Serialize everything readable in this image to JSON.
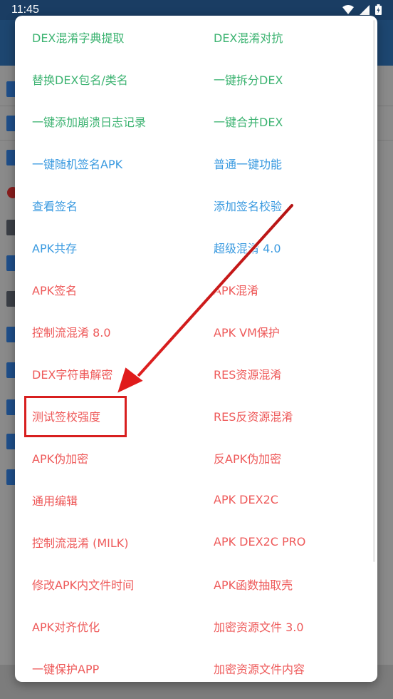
{
  "status_bar": {
    "time": "11:45"
  },
  "menu": {
    "rows": [
      {
        "left": {
          "label": "DEX混淆字典提取",
          "color": "green"
        },
        "right": {
          "label": "DEX混淆对抗",
          "color": "green"
        }
      },
      {
        "left": {
          "label": "替换DEX包名/类名",
          "color": "green"
        },
        "right": {
          "label": "一键拆分DEX",
          "color": "green"
        }
      },
      {
        "left": {
          "label": "一键添加崩溃日志记录",
          "color": "green"
        },
        "right": {
          "label": "一键合并DEX",
          "color": "green"
        }
      },
      {
        "left": {
          "label": "一键随机签名APK",
          "color": "blue"
        },
        "right": {
          "label": "普通一键功能",
          "color": "blue"
        }
      },
      {
        "left": {
          "label": "查看签名",
          "color": "blue"
        },
        "right": {
          "label": "添加签名校验",
          "color": "blue"
        }
      },
      {
        "left": {
          "label": "APK共存",
          "color": "blue"
        },
        "right": {
          "label": "超级混淆 4.0",
          "color": "blue"
        }
      },
      {
        "left": {
          "label": "APK签名",
          "color": "red"
        },
        "right": {
          "label": "APK混淆",
          "color": "red"
        }
      },
      {
        "left": {
          "label": "控制流混淆 8.0",
          "color": "red"
        },
        "right": {
          "label": "APK VM保护",
          "color": "red"
        }
      },
      {
        "left": {
          "label": "DEX字符串解密",
          "color": "red"
        },
        "right": {
          "label": "RES资源混淆",
          "color": "red"
        }
      },
      {
        "left": {
          "label": "测试签校强度",
          "color": "red"
        },
        "right": {
          "label": "RES反资源混淆",
          "color": "red"
        }
      },
      {
        "left": {
          "label": "APK伪加密",
          "color": "red"
        },
        "right": {
          "label": "反APK伪加密",
          "color": "red"
        }
      },
      {
        "left": {
          "label": "通用编辑",
          "color": "red"
        },
        "right": {
          "label": "APK DEX2C",
          "color": "red"
        }
      },
      {
        "left": {
          "label": "控制流混淆 (MILK)",
          "color": "red"
        },
        "right": {
          "label": "APK DEX2C PRO",
          "color": "red"
        }
      },
      {
        "left": {
          "label": "修改APK内文件时间",
          "color": "red"
        },
        "right": {
          "label": "APK函数抽取壳",
          "color": "red"
        }
      },
      {
        "left": {
          "label": "APK对齐优化",
          "color": "red"
        },
        "right": {
          "label": "加密资源文件 3.0",
          "color": "red"
        }
      },
      {
        "left": {
          "label": "一键保护APP",
          "color": "red"
        },
        "right": {
          "label": "加密资源文件内容",
          "color": "red"
        }
      }
    ]
  },
  "colors": {
    "green": "#3cb371",
    "blue": "#3a9ae0",
    "red": "#ee5a5a",
    "annotation": "#d81f1f"
  },
  "annotation": {
    "highlighted_item": "测试签校强度"
  }
}
